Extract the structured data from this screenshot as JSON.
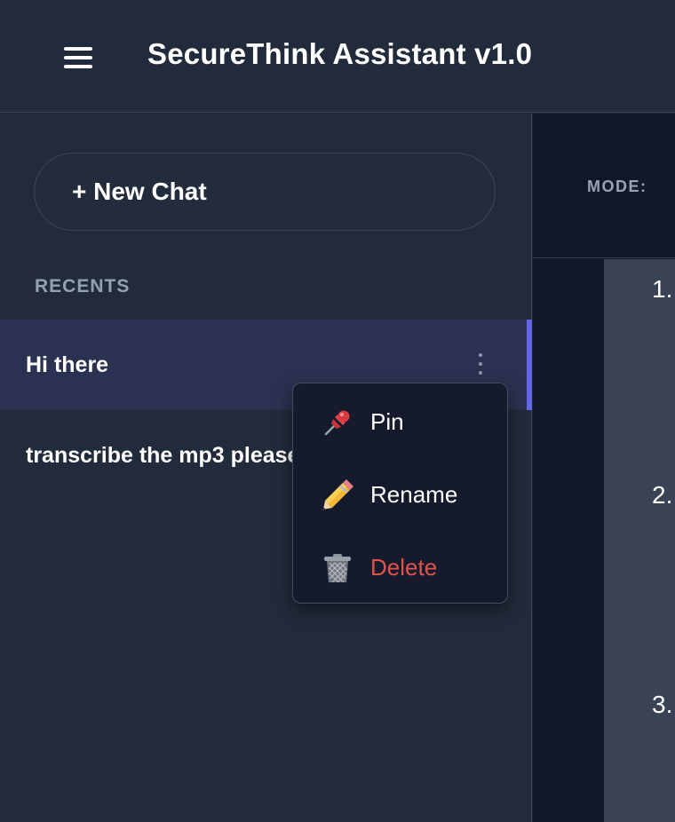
{
  "header": {
    "title": "SecureThink Assistant v1.0",
    "menu_icon": "hamburger-menu-icon"
  },
  "sidebar": {
    "new_chat_label": "+ New Chat",
    "recents_label": "RECENTS",
    "chats": [
      {
        "title": "Hi there",
        "active": true
      },
      {
        "title": "transcribe the mp3 please"
      }
    ]
  },
  "context_menu": {
    "items": [
      {
        "label": "Pin",
        "icon": "pushpin-icon"
      },
      {
        "label": "Rename",
        "icon": "pencil-icon"
      },
      {
        "label": "Delete",
        "icon": "trash-icon",
        "color": "#e0534d"
      }
    ]
  },
  "main": {
    "mode_label": "MODE:",
    "list_numbers": [
      "1.",
      "2.",
      "3."
    ]
  },
  "colors": {
    "accent": "#6466e8",
    "danger": "#e0534d"
  }
}
